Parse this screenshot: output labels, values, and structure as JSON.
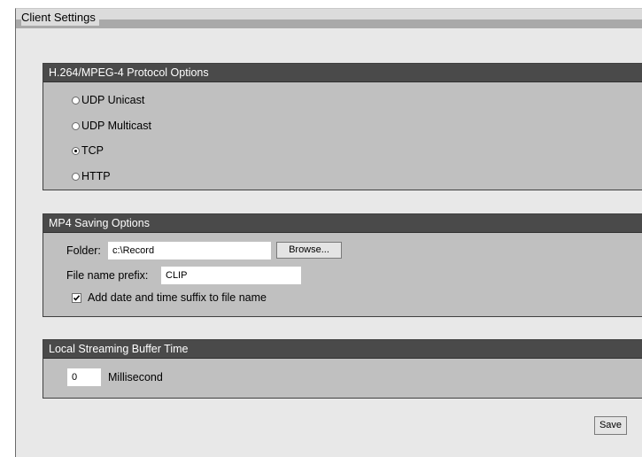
{
  "window": {
    "title": "Client Settings"
  },
  "protocol_panel": {
    "header": "H.264/MPEG-4 Protocol Options",
    "options": [
      {
        "label": "UDP Unicast",
        "selected": false
      },
      {
        "label": "UDP Multicast",
        "selected": false
      },
      {
        "label": "TCP",
        "selected": true
      },
      {
        "label": "HTTP",
        "selected": false
      }
    ]
  },
  "mp4_panel": {
    "header": "MP4 Saving Options",
    "folder_label": "Folder:",
    "folder_value": "c:\\Record",
    "browse_label": "Browse...",
    "prefix_label": "File name prefix:",
    "prefix_value": "CLIP",
    "suffix_checkbox_label": "Add date and time suffix to file name",
    "suffix_checked": true
  },
  "buffer_panel": {
    "header": "Local Streaming Buffer Time",
    "value": "0",
    "unit_label": "Millisecond"
  },
  "save_label": "Save"
}
